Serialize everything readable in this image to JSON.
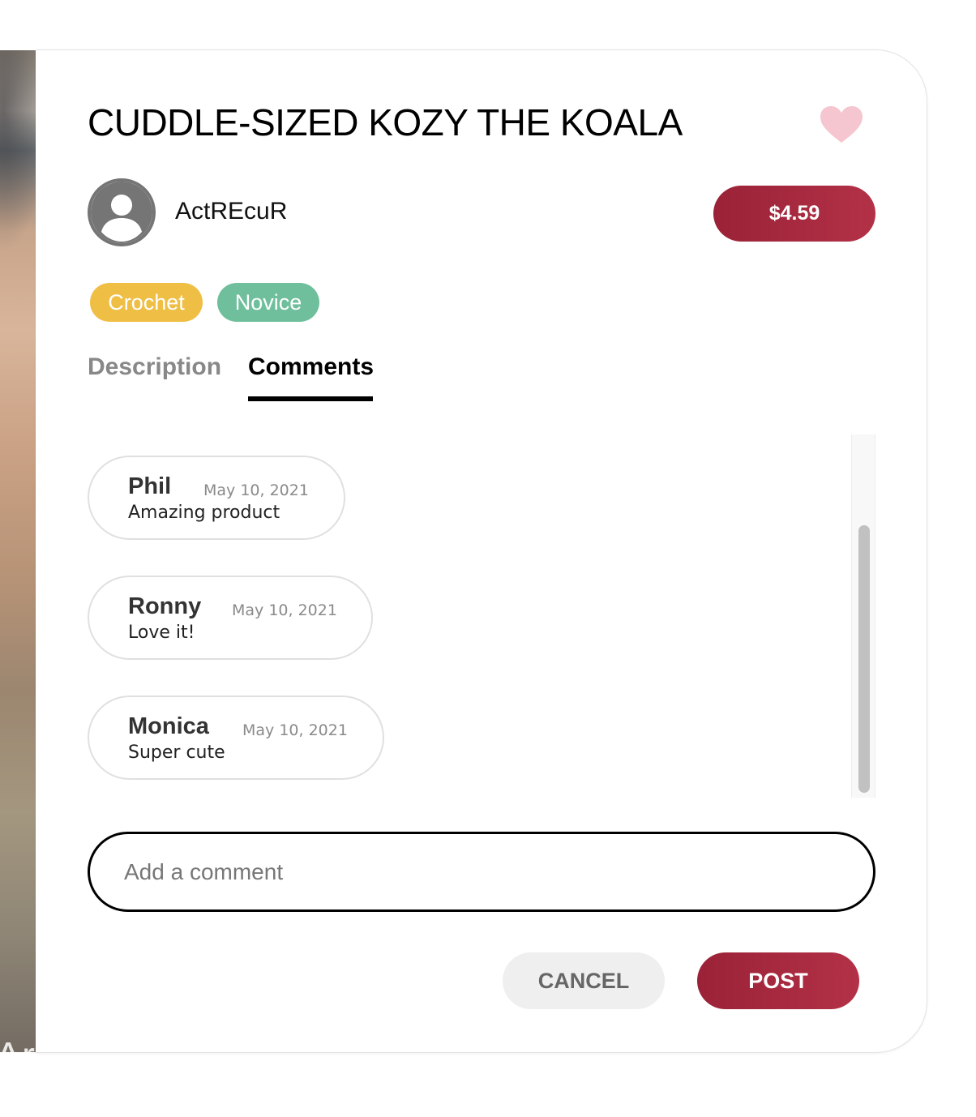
{
  "product": {
    "title": "CUDDLE-SIZED KOZY THE KOALA",
    "favorite_icon": "heart-icon",
    "favorite_color": "#f5c6cf"
  },
  "seller": {
    "username": "ActREcuR",
    "avatar_icon": "user-avatar-icon"
  },
  "price": {
    "label": "$4.59",
    "color": "#a52a3e"
  },
  "tags": [
    {
      "label": "Crochet",
      "color": "#efbe44"
    },
    {
      "label": "Novice",
      "color": "#6fbf9c"
    }
  ],
  "tabs": [
    {
      "label": "Description",
      "active": false
    },
    {
      "label": "Comments",
      "active": true
    }
  ],
  "comments": [
    {
      "author": "Phil",
      "date": "May 10, 2021",
      "text": "Amazing product"
    },
    {
      "author": "Ronny",
      "date": "May 10, 2021",
      "text": "Love it!"
    },
    {
      "author": "Monica",
      "date": "May 10, 2021",
      "text": "Super cute"
    }
  ],
  "comment_form": {
    "placeholder": "Add a comment",
    "value": "",
    "cancel_label": "CANCEL",
    "post_label": "POST"
  },
  "background_photo": {
    "caption_fragment": "Ar"
  }
}
